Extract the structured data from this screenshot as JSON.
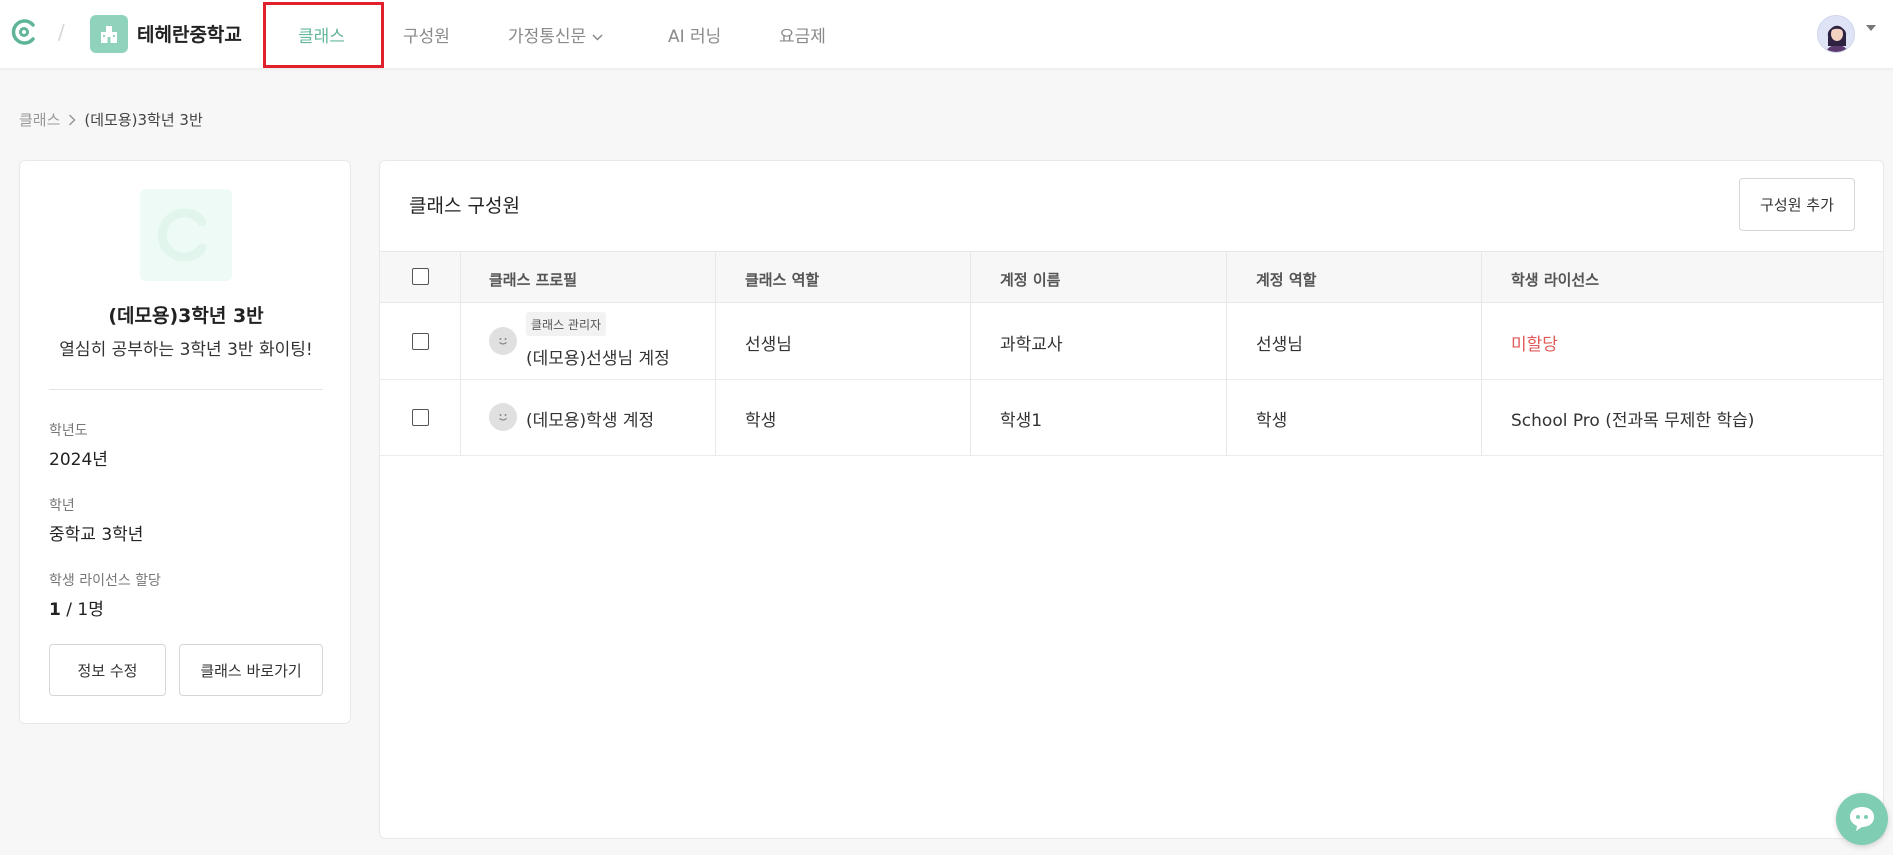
{
  "header": {
    "school_name": "테헤란중학교",
    "nav": [
      {
        "label": "클래스",
        "active": true
      },
      {
        "label": "구성원",
        "active": false
      },
      {
        "label": "가정통신문",
        "active": false,
        "has_dropdown": true
      },
      {
        "label": "AI 러닝",
        "active": false
      },
      {
        "label": "요금제",
        "active": false
      }
    ],
    "logo_icon": "brand-c-logo-icon",
    "school_icon": "school-building-icon",
    "avatar_icon": "user-avatar-icon"
  },
  "breadcrumb": {
    "root": "클래스",
    "current": "(데모용)3학년 3반"
  },
  "class_info": {
    "title": "(데모용)3학년 3반",
    "description": "열심히 공부하는 3학년 3반 화이팅!",
    "fields": [
      {
        "label": "학년도",
        "value": "2024년"
      },
      {
        "label": "학년",
        "value": "중학교 3학년"
      }
    ],
    "license_label": "학생 라이선스 할당",
    "license_used": "1",
    "license_total": " / 1명",
    "edit_button": "정보 수정",
    "go_button": "클래스 바로가기"
  },
  "members": {
    "title": "클래스 구성원",
    "add_button": "구성원 추가",
    "columns": [
      "클래스 프로필",
      "클래스 역할",
      "계정 이름",
      "계정 역할",
      "학생 라이선스"
    ],
    "rows": [
      {
        "tag": "클래스 관리자",
        "profile": "(데모용)선생님 계정",
        "class_role": "선생님",
        "account_name": "과학교사",
        "account_role": "선생님",
        "license": "미할당",
        "license_status": "unassigned"
      },
      {
        "tag": "",
        "profile": "(데모용)학생 계정",
        "class_role": "학생",
        "account_name": "학생1",
        "account_role": "학생",
        "license": "School Pro (전과목 무제한 학습)",
        "license_status": "assigned"
      }
    ]
  },
  "colors": {
    "accent": "#67b79b",
    "highlight_box": "#e0202a",
    "unassigned": "#e05a5a"
  },
  "chat_icon": "chat-bubble-icon"
}
